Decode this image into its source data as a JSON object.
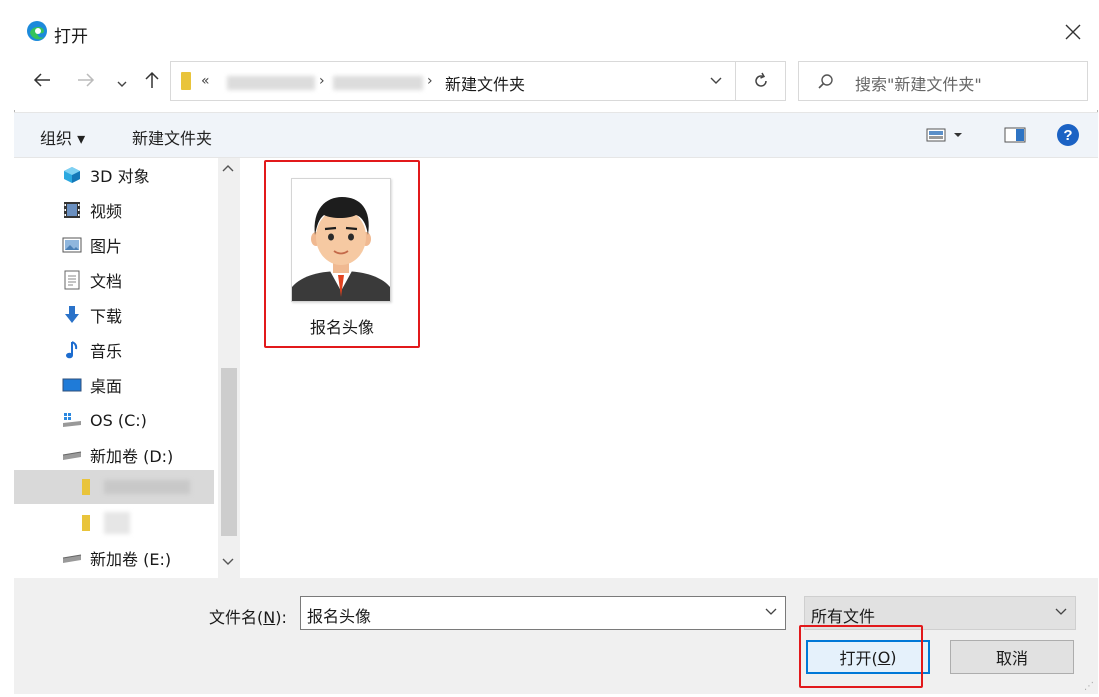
{
  "window": {
    "title": "打开"
  },
  "address": {
    "current_folder": "新建文件夹",
    "overflow": "«"
  },
  "search": {
    "placeholder": "搜索\"新建文件夹\""
  },
  "commands": {
    "organize": "组织 ▾",
    "new_folder": "新建文件夹"
  },
  "sidebar": {
    "items": [
      {
        "label": "3D 对象",
        "icon": "3d-objects-icon"
      },
      {
        "label": "视频",
        "icon": "videos-icon"
      },
      {
        "label": "图片",
        "icon": "pictures-icon"
      },
      {
        "label": "文档",
        "icon": "documents-icon"
      },
      {
        "label": "下载",
        "icon": "downloads-icon"
      },
      {
        "label": "音乐",
        "icon": "music-icon"
      },
      {
        "label": "桌面",
        "icon": "desktop-icon"
      },
      {
        "label": "OS (C:)",
        "icon": "drive-c-icon"
      },
      {
        "label": "新加卷 (D:)",
        "icon": "drive-icon"
      },
      {
        "label": "新加卷 (E:)",
        "icon": "drive-icon"
      }
    ]
  },
  "files": [
    {
      "name": "报名头像"
    }
  ],
  "footer": {
    "filename_label_pre": "文件名(",
    "filename_label_key": "N",
    "filename_label_post": "):",
    "filename_value": "报名头像",
    "filter_value": "所有文件",
    "open_pre": "打开(",
    "open_key": "O",
    "open_post": ")",
    "cancel": "取消"
  },
  "colors": {
    "accent": "#0078d7",
    "highlight": "#e2191b",
    "folder": "#e9c43b"
  }
}
